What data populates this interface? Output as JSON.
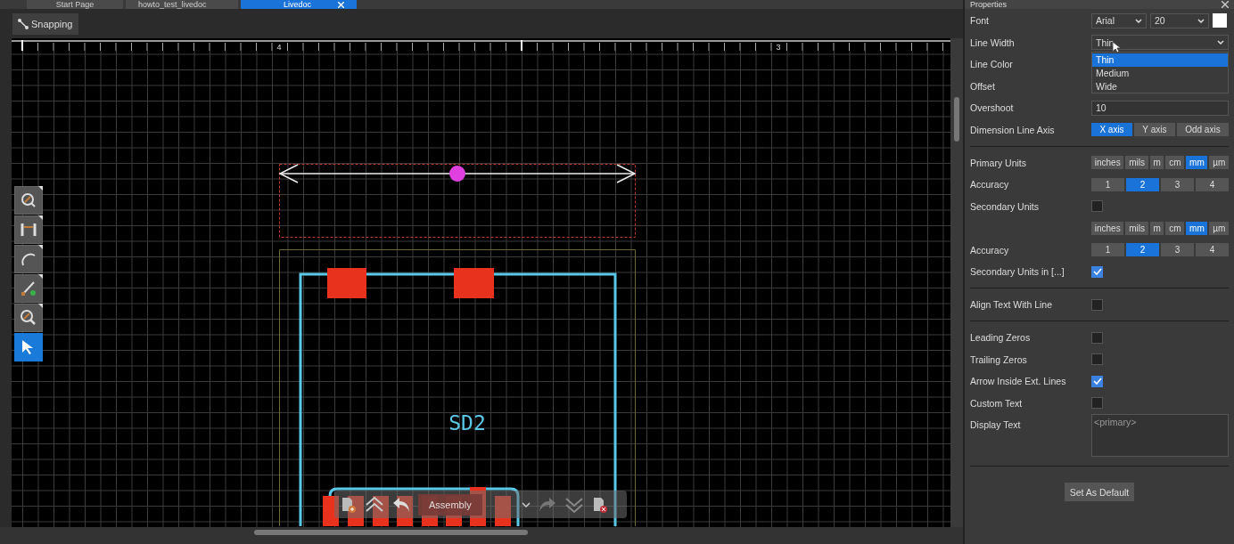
{
  "tabs": [
    {
      "label": "Start Page",
      "selected": false
    },
    {
      "label": "howto_test_livedoc",
      "selected": false
    },
    {
      "label": "Livedoc",
      "selected": true
    }
  ],
  "toolbar": {
    "snapping": "Snapping"
  },
  "canvas": {
    "ruler_labels": [
      "4",
      "3"
    ],
    "component_label": "SD2",
    "tools": [
      {
        "kind": "zoom-area",
        "selected": false
      },
      {
        "kind": "dimension",
        "selected": false
      },
      {
        "kind": "arc",
        "selected": false
      },
      {
        "kind": "line",
        "selected": false
      },
      {
        "kind": "zoom",
        "selected": false
      },
      {
        "kind": "pointer",
        "selected": true
      }
    ],
    "layer_bar": {
      "layer": "Assembly"
    }
  },
  "properties": {
    "title": "Properties",
    "rows": [
      {
        "kind": "font",
        "label": "Font",
        "family": "Arial",
        "size": "20"
      },
      {
        "kind": "select",
        "label": "Line Width",
        "value": "Thin",
        "options": [
          {
            "label": "Thin",
            "selected": true
          },
          {
            "label": "Medium",
            "selected": false
          },
          {
            "label": "Wide",
            "selected": false
          }
        ]
      },
      {
        "kind": "label",
        "label": "Line Color"
      },
      {
        "kind": "label",
        "label": "Offset"
      },
      {
        "kind": "text",
        "label": "Overshoot",
        "value": "10"
      },
      {
        "kind": "segmented",
        "label": "Dimension Line Axis",
        "options": [
          {
            "label": "X axis",
            "selected": true
          },
          {
            "label": "Y axis",
            "selected": false
          },
          {
            "label": "Odd axis",
            "selected": false
          }
        ]
      },
      {
        "kind": "segmented",
        "label": "Primary Units",
        "separator_before": true,
        "options": [
          {
            "label": "inches",
            "selected": false
          },
          {
            "label": "mils",
            "selected": false
          },
          {
            "label": "m",
            "selected": false
          },
          {
            "label": "cm",
            "selected": false
          },
          {
            "label": "mm",
            "selected": true
          },
          {
            "label": "µm",
            "selected": false
          }
        ]
      },
      {
        "kind": "segmented",
        "label": "Accuracy",
        "equal": true,
        "options": [
          {
            "label": "1",
            "selected": false
          },
          {
            "label": "2",
            "selected": true
          },
          {
            "label": "3",
            "selected": false
          },
          {
            "label": "4",
            "selected": false
          }
        ]
      },
      {
        "kind": "checkbox",
        "label": "Secondary Units",
        "checked": false
      },
      {
        "kind": "segmented",
        "options": [
          {
            "label": "inches",
            "selected": false
          },
          {
            "label": "mils",
            "selected": false
          },
          {
            "label": "m",
            "selected": false
          },
          {
            "label": "cm",
            "selected": false
          },
          {
            "label": "mm",
            "selected": true
          },
          {
            "label": "µm",
            "selected": false
          }
        ]
      },
      {
        "kind": "segmented",
        "label": "Accuracy",
        "equal": true,
        "options": [
          {
            "label": "1",
            "selected": false
          },
          {
            "label": "2",
            "selected": true
          },
          {
            "label": "3",
            "selected": false
          },
          {
            "label": "4",
            "selected": false
          }
        ]
      },
      {
        "kind": "checkbox",
        "label": "Secondary Units in [...]",
        "checked": true
      },
      {
        "kind": "checkbox",
        "label": "Align Text With Line",
        "separator_before": true,
        "checked": false
      },
      {
        "kind": "checkbox",
        "label": "Leading Zeros",
        "separator_before": true,
        "checked": false
      },
      {
        "kind": "checkbox",
        "label": "Trailing Zeros",
        "checked": false
      },
      {
        "kind": "checkbox",
        "label": "Arrow Inside Ext. Lines",
        "checked": true
      },
      {
        "kind": "checkbox",
        "label": "Custom Text",
        "checked": false
      },
      {
        "kind": "textarea",
        "label": "Display Text",
        "placeholder": "<primary>"
      }
    ],
    "default_button": "Set As Default"
  }
}
